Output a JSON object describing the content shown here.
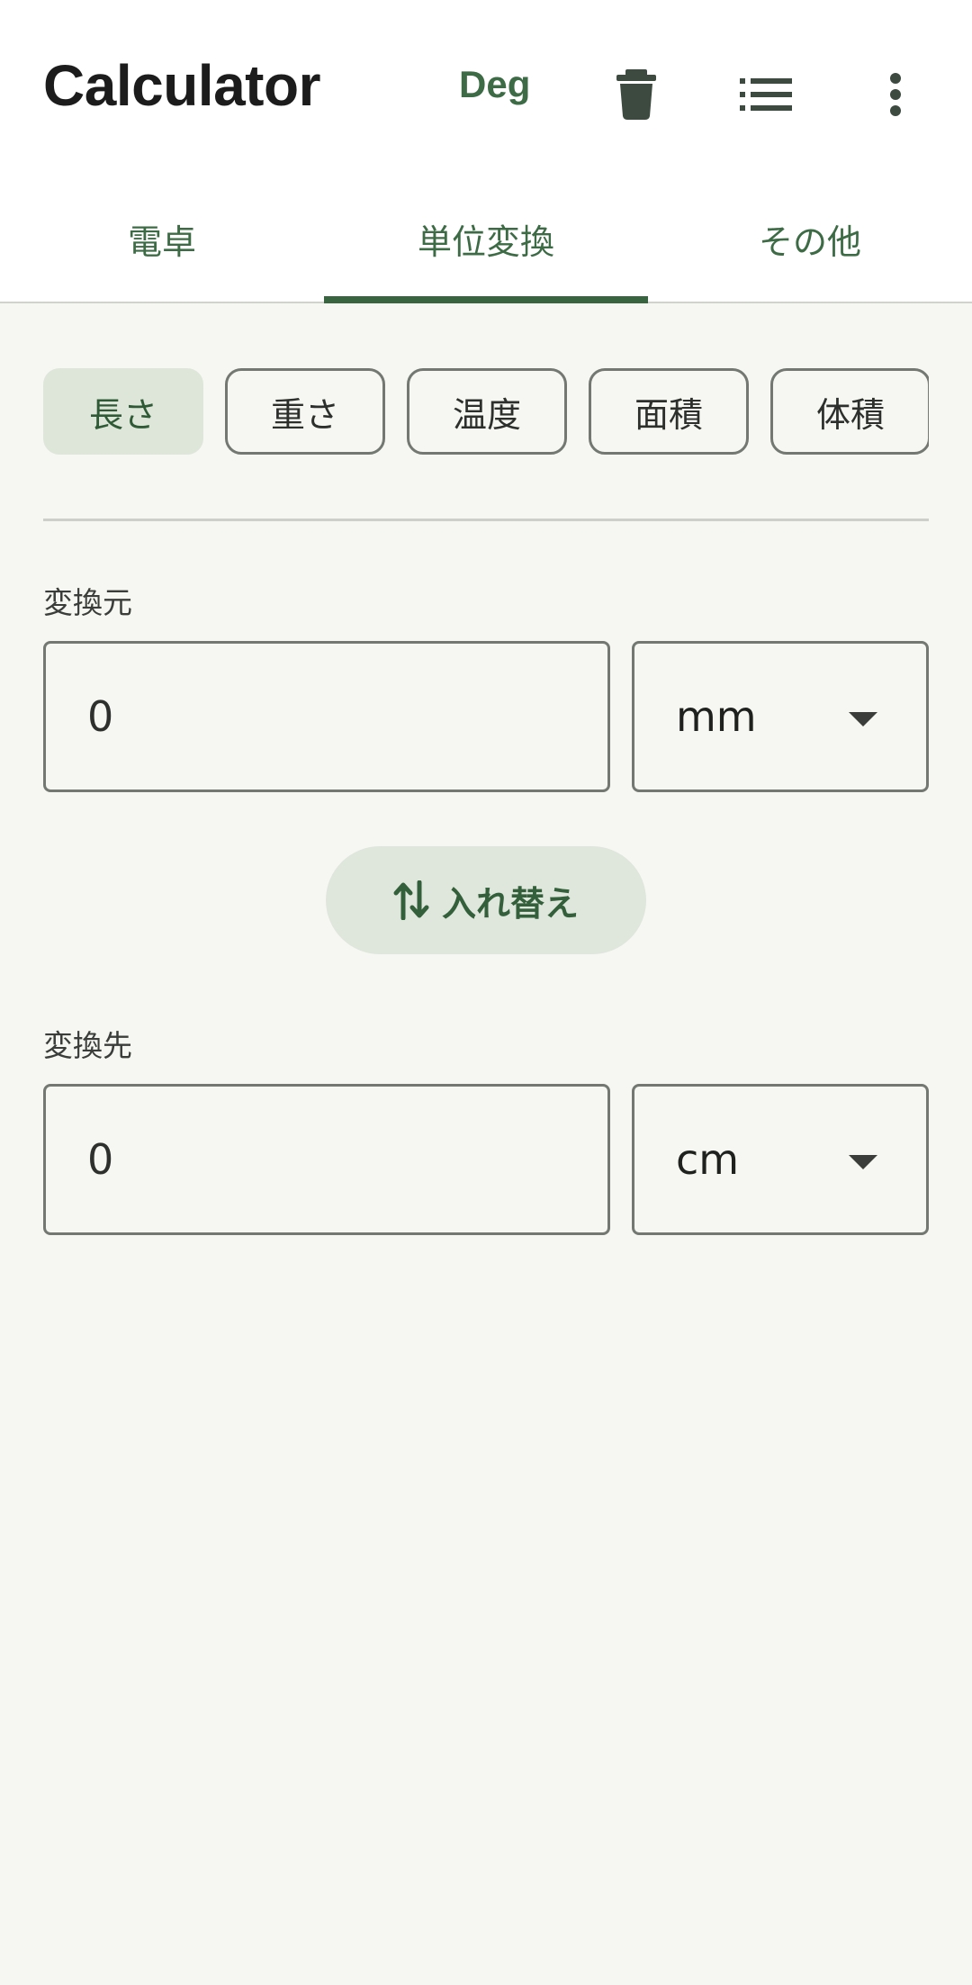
{
  "appbar": {
    "title": "Calculator",
    "angle_mode": "Deg",
    "icons": [
      "trash-icon",
      "history-list-icon",
      "more-vert-icon"
    ]
  },
  "tabs": [
    {
      "label": "電卓"
    },
    {
      "label": "単位変換",
      "active": true
    },
    {
      "label": "その他"
    }
  ],
  "categories": [
    {
      "label": "長さ",
      "selected": true
    },
    {
      "label": "重さ"
    },
    {
      "label": "温度"
    },
    {
      "label": "面積"
    },
    {
      "label": "体積"
    }
  ],
  "converter": {
    "from_label": "変換元",
    "from_value": "0",
    "from_unit": "mm",
    "swap_label": "入れ替え",
    "to_label": "変換先",
    "to_value": "0",
    "to_unit": "cm"
  },
  "colors": {
    "accent": "#38643f",
    "chip_selected_bg": "#dee6da",
    "background": "#f6f7f2"
  }
}
